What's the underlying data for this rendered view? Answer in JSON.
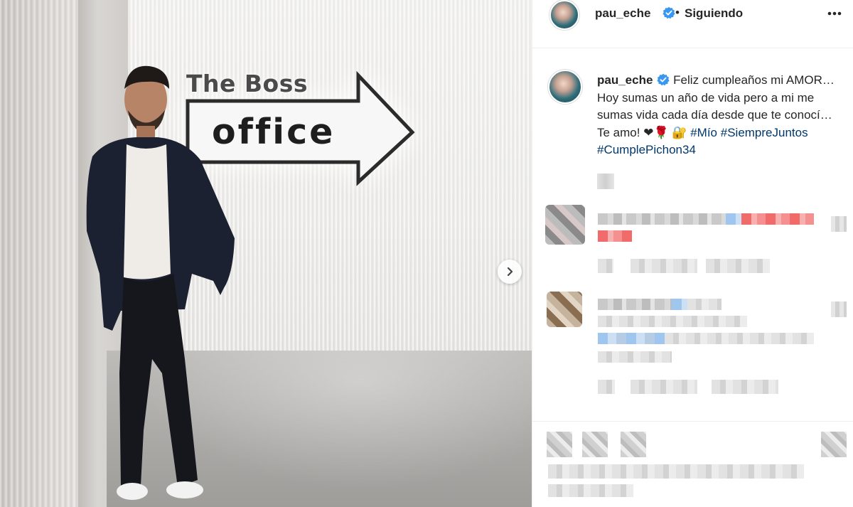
{
  "photo": {
    "sign_title": "The Boss",
    "sign_word": "office",
    "next_button_icon": "chevron-right-icon"
  },
  "post": {
    "username": "pau_eche",
    "verified_icon": "verified-badge-icon",
    "separator": "•",
    "follow_status": "Siguiendo",
    "more_icon": "more-options-icon",
    "caption_text": "Feliz cumpleaños mi AMOR… Hoy sumas un año de vida pero a mi me sumas vida cada día desde que te conocí… Te amo! ❤🌹 🔐 ",
    "hashtags": [
      "#Mío",
      "#SiempreJuntos",
      "#CumplePichon34"
    ]
  },
  "colors": {
    "accent_link": "#00376b",
    "verified": "#3897f0",
    "text": "#262626",
    "border": "#efefef"
  }
}
